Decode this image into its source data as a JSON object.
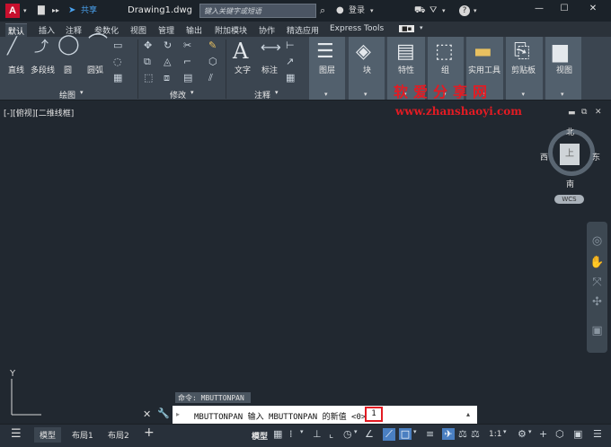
{
  "titlebar": {
    "logo": "A",
    "share_label": "共享",
    "document_title": "Drawing1.dwg",
    "search_placeholder": "键入关键字或短语",
    "login_label": "登录"
  },
  "tabs": [
    {
      "label": "默认",
      "active": true
    },
    {
      "label": "插入"
    },
    {
      "label": "注释"
    },
    {
      "label": "参数化"
    },
    {
      "label": "视图"
    },
    {
      "label": "管理"
    },
    {
      "label": "输出"
    },
    {
      "label": "附加模块"
    },
    {
      "label": "协作"
    },
    {
      "label": "精选应用"
    },
    {
      "label": "Express Tools"
    }
  ],
  "ribbon": {
    "draw": {
      "line": "直线",
      "polyline": "多段线",
      "circle": "圆",
      "arc": "圆弧",
      "panel": "绘图"
    },
    "modify": {
      "panel": "修改"
    },
    "annotation": {
      "text": "文字",
      "dimension": "标注",
      "panel": "注释"
    },
    "tools": [
      {
        "label": "图层"
      },
      {
        "label": "块"
      },
      {
        "label": "特性"
      },
      {
        "label": "组"
      },
      {
        "label": "实用工具"
      },
      {
        "label": "剪贴板"
      },
      {
        "label": "视图"
      }
    ]
  },
  "watermark": {
    "cn": "软爱分享网",
    "url": "www.zhanshaoyi.com"
  },
  "viewport": {
    "label": "[-][俯视][二维线框]",
    "cube_face": "上",
    "north": "北",
    "south": "南",
    "east": "东",
    "west": "西",
    "wcs": "WCS",
    "ucs_y": "Y"
  },
  "command": {
    "history": "命令: MBUTTONPAN",
    "prompt": "MBUTTONPAN 输入 MBUTTONPAN 的新值 <0>:",
    "input": "1"
  },
  "statusbar": {
    "layouts": [
      {
        "label": "模型",
        "active": true
      },
      {
        "label": "布局1"
      },
      {
        "label": "布局2"
      }
    ],
    "model_label": "模型",
    "scale": "1:1"
  },
  "colors": {
    "accent_red": "#e31b23",
    "logo_red": "#c8102e",
    "canvas": "#212830",
    "ribbon": "#3b4550"
  }
}
